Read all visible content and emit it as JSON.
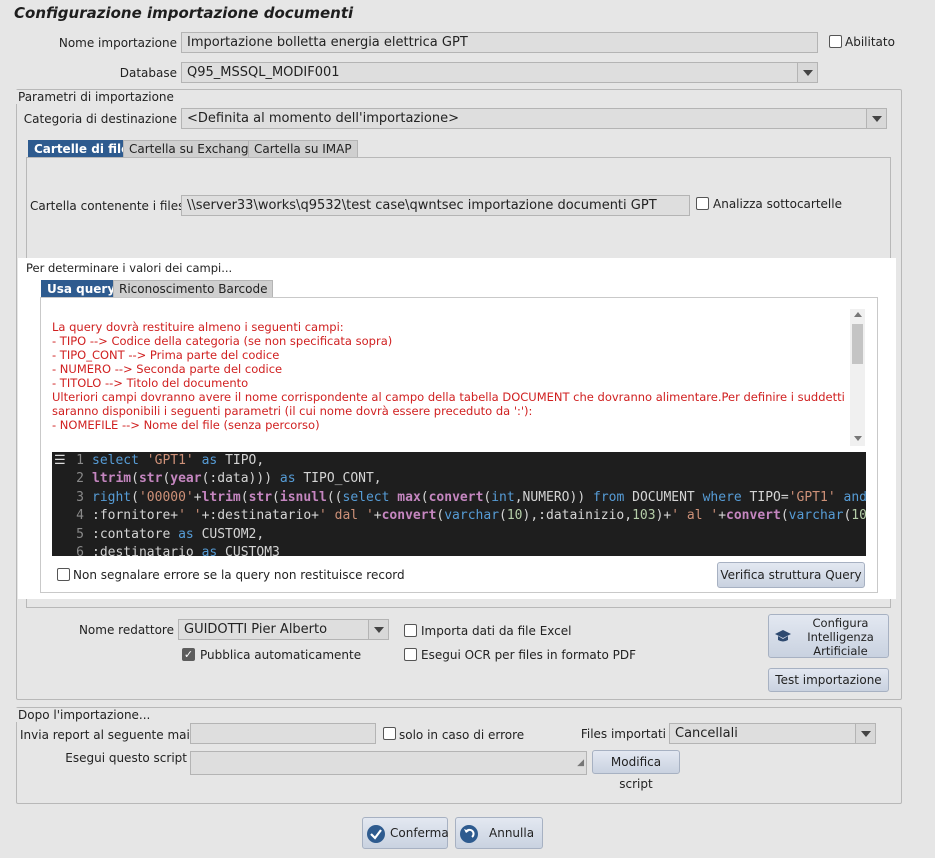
{
  "title": "Configurazione importazione documenti",
  "nome_importazione": {
    "label": "Nome importazione",
    "value": "Importazione bolletta energia elettrica GPT"
  },
  "abilitato": {
    "label": "Abilitato",
    "checked": false
  },
  "database": {
    "label": "Database",
    "value": "Q95_MSSQL_MODIF001"
  },
  "parametri": {
    "group_label": "Parametri di importazione",
    "categoria_label": "Categoria di destinazione",
    "categoria_value": "<Definita al momento dell'importazione>",
    "tabs": [
      "Cartelle di file",
      "Cartella su Exchange",
      "Cartella su IMAP"
    ],
    "cartella_label": "Cartella contenente i files",
    "cartella_value": "\\\\server33\\works\\q9532\\test case\\qwntsec importazione documenti GPT",
    "analizza_label": "Analizza sottocartelle"
  },
  "valori": {
    "group_label": "Per determinare i valori dei campi...",
    "tabs": [
      "Usa query",
      "Riconoscimento Barcode"
    ],
    "info_lines": [
      "La query dovrà restituire almeno i seguenti campi:",
      "",
      "- TIPO --> Codice della categoria (se non specificata sopra)",
      "- TIPO_CONT --> Prima parte del codice",
      "- NUMERO --> Seconda parte del codice",
      "- TITOLO --> Titolo del documento",
      "",
      "Ulteriori campi dovranno avere il nome corrispondente al campo della tabella DOCUMENT che dovranno alimentare.Per definire i suddetti campi,",
      "saranno disponibili i seguenti parametri (il cui nome dovrà essere preceduto da ':'):",
      "- NOMEFILE --> Nome del file (senza percorso)"
    ],
    "code_line_numbers": [
      "1",
      "2",
      "3",
      "4",
      "5",
      "6"
    ],
    "no_error_label": "Non segnalare errore se la query non restituisce record",
    "verify_button": "Verifica struttura Query"
  },
  "redattore": {
    "label": "Nome redattore",
    "value": "GUIDOTTI Pier Alberto"
  },
  "pubblica": {
    "label": "Pubblica automaticamente",
    "checked": true
  },
  "importa_excel": {
    "label": "Importa dati da file Excel",
    "checked": false
  },
  "esegui_ocr": {
    "label": "Esegui OCR per files in formato PDF",
    "checked": false
  },
  "configura_ai_button": [
    "Configura",
    "Intelligenza",
    "Artificiale"
  ],
  "test_button": "Test importazione",
  "dopo": {
    "group_label": "Dopo l'importazione...",
    "invia_label": "Invia report al seguente mail",
    "invia_value": "",
    "solo_errore_label": "solo in caso di errore",
    "files_label": "Files importati",
    "files_value": "Cancellali",
    "script_label": "Esegui questo script",
    "modifica_button": "Modifica script"
  },
  "footer": {
    "conferma": "Conferma",
    "annulla": "Annulla"
  }
}
